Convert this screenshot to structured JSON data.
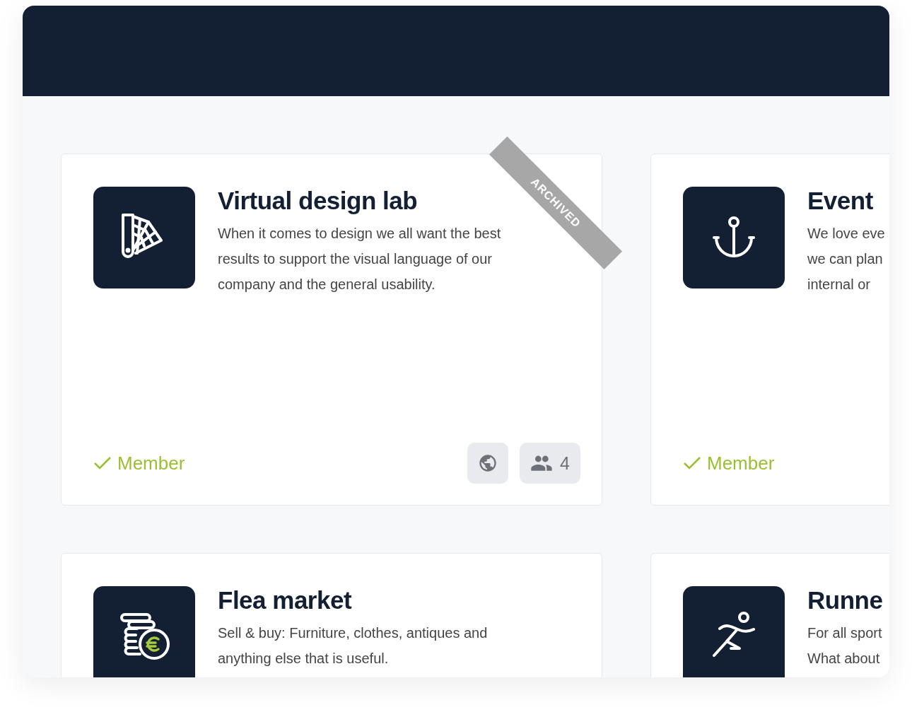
{
  "cards": [
    {
      "kind": "palette",
      "title": "Virtual design lab",
      "description": "When it comes to design we all want the best\nresults to support the visual language of our\ncompany and the general usability.",
      "ribbon": "ARCHIVED",
      "member_label": "Member",
      "public": true,
      "members_count": "4"
    },
    {
      "kind": "anchor",
      "title": "Event",
      "description": "We love eve\nwe can plan\ninternal or",
      "member_label": "Member"
    },
    {
      "kind": "coins",
      "title": "Flea market",
      "description": "Sell & buy: Furniture, clothes, antiques and\nanything else that is useful."
    },
    {
      "kind": "runner",
      "title": "Runne",
      "description": "For all sport\nWhat about"
    }
  ]
}
